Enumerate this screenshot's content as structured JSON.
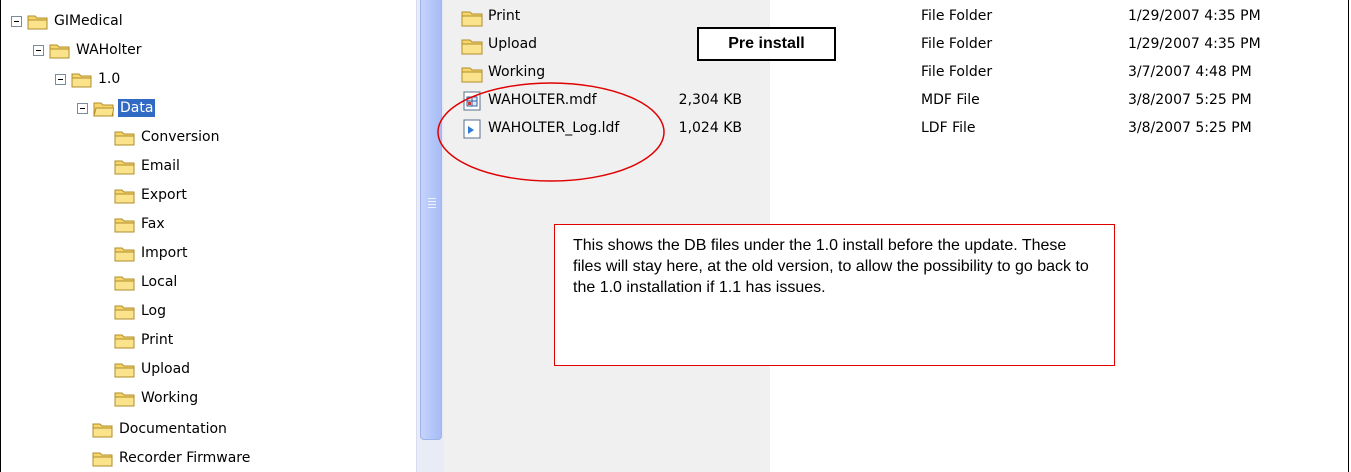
{
  "tree": [
    {
      "label": "GIMedical",
      "expanded": true
    },
    {
      "label": "WAHolter",
      "expanded": true
    },
    {
      "label": "1.0",
      "expanded": true
    },
    {
      "label": "Data",
      "expanded": true,
      "selected": true
    },
    {
      "label": "Conversion"
    },
    {
      "label": "Email"
    },
    {
      "label": "Export"
    },
    {
      "label": "Fax"
    },
    {
      "label": "Import"
    },
    {
      "label": "Local"
    },
    {
      "label": "Log"
    },
    {
      "label": "Print"
    },
    {
      "label": "Upload"
    },
    {
      "label": "Working"
    },
    {
      "label": "Documentation"
    },
    {
      "label": "Recorder Firmware"
    }
  ],
  "files": [
    {
      "name": "Print",
      "size": "",
      "type": "File Folder",
      "modified": "1/29/2007 4:35 PM",
      "icon": "folder-icon"
    },
    {
      "name": "Upload",
      "size": "",
      "type": "File Folder",
      "modified": "1/29/2007 4:35 PM",
      "icon": "folder-icon"
    },
    {
      "name": "Working",
      "size": "",
      "type": "File Folder",
      "modified": "3/7/2007 4:48 PM",
      "icon": "folder-icon"
    },
    {
      "name": "WAHOLTER.mdf",
      "size": "2,304 KB",
      "type": "MDF File",
      "modified": "3/8/2007 5:25 PM",
      "icon": "mdf-file-icon"
    },
    {
      "name": "WAHOLTER_Log.ldf",
      "size": "1,024 KB",
      "type": "LDF File",
      "modified": "3/8/2007 5:25 PM",
      "icon": "ldf-file-icon"
    }
  ],
  "annotations": {
    "pre_install": "Pre install",
    "note": "This shows the DB files under the 1.0 install before the update.  These files will stay here, at the old version, to allow the possibility to go back to the 1.0 installation if 1.1 has issues."
  },
  "colors": {
    "selection": "#316ac5",
    "annotation_red": "#e00000",
    "folder_yellow": "#f6d66b"
  }
}
